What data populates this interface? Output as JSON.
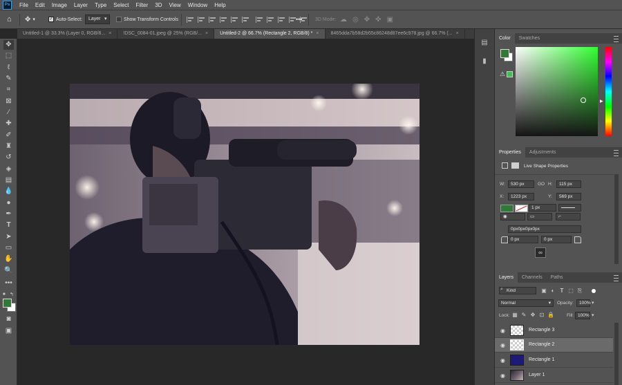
{
  "menu": [
    "File",
    "Edit",
    "Image",
    "Layer",
    "Type",
    "Select",
    "Filter",
    "3D",
    "View",
    "Window",
    "Help"
  ],
  "app_logo": "Ps",
  "options": {
    "auto_select_label": "Auto-Select:",
    "auto_select_value": "Layer",
    "transform_label": "Show Transform Controls",
    "mode_3d_label": "3D Mode:",
    "more": "•••"
  },
  "tabs": [
    {
      "label": "Untitled-1 @ 33.3% (Layer 0, RGB/8...",
      "active": false
    },
    {
      "label": "!DSC_0084-01.jpeg @ 25% (RGB/...",
      "active": false
    },
    {
      "label": "Untitled-2 @ 66.7% (Rectangle 2, RGB/8) *",
      "active": true
    },
    {
      "label": "8465dda7b58d2b55c86248d87ee6c978.jpg @ 66.7% (...",
      "active": false
    }
  ],
  "tab_close": "×",
  "color_panel": {
    "tabs": [
      "Color",
      "Swatches"
    ],
    "foreground": "#2f7a36",
    "background": "#ffffff"
  },
  "properties": {
    "tabs": [
      "Properties",
      "Adjustments"
    ],
    "subtitle": "Live Shape Properties",
    "w_label": "W:",
    "w": "530 px",
    "h_label": "H:",
    "h": "115 px",
    "x_label": "X:",
    "x": "1223 px",
    "y_label": "Y:",
    "y": "569 px",
    "link_symbol": "GO",
    "stroke_width": "1 px",
    "radius_all": "0px0px0px0px",
    "radius_a": "0 px",
    "radius_b": "0 px",
    "fill_color": "#2f7a36"
  },
  "layers_panel": {
    "tabs": [
      "Layers",
      "Channels",
      "Paths"
    ],
    "kind_label": "Kind",
    "blend_mode": "Normal",
    "opacity_label": "Opacity:",
    "opacity": "100%",
    "lock_label": "Lock:",
    "fill_label": "Fill:",
    "fill": "100%",
    "layers": [
      {
        "name": "Rectangle 3",
        "selected": false,
        "thumb": "checker"
      },
      {
        "name": "Rectangle 2",
        "selected": true,
        "thumb": "checker"
      },
      {
        "name": "Rectangle 1",
        "selected": false,
        "thumb": "#1d1a78"
      },
      {
        "name": "Layer 1",
        "selected": false,
        "thumb": "photo"
      }
    ]
  },
  "toolbar_icons": [
    "move-icon",
    "marquee-icon",
    "lasso-icon",
    "quick-select-icon",
    "crop-icon",
    "frame-icon",
    "eyedropper-icon",
    "healing-brush-icon",
    "brush-icon",
    "clone-stamp-icon",
    "history-brush-icon",
    "eraser-icon",
    "gradient-icon",
    "blur-icon",
    "dodge-icon",
    "pen-icon",
    "type-icon",
    "path-select-icon",
    "rectangle-icon",
    "hand-icon",
    "zoom-icon",
    "more-tools-icon"
  ]
}
